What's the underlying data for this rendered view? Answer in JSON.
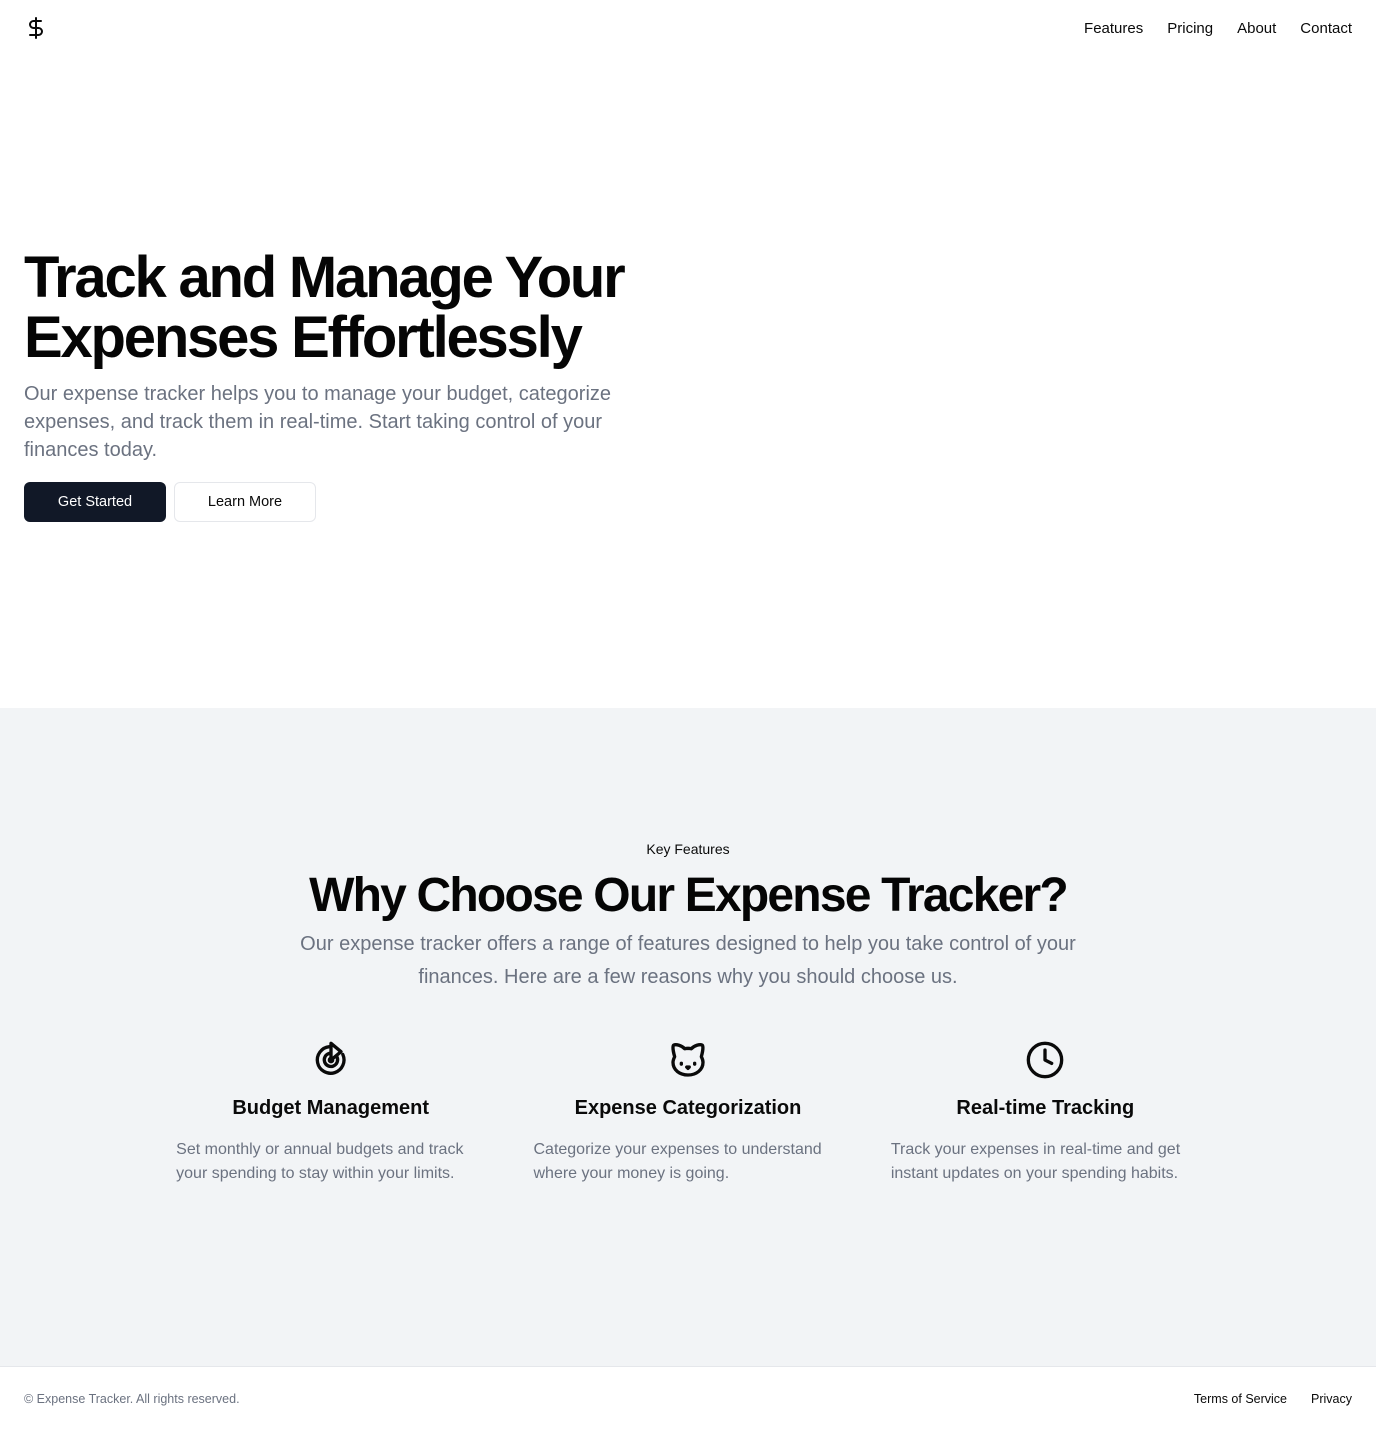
{
  "header": {
    "logo_icon": "dollar-sign-icon",
    "nav": [
      "Features",
      "Pricing",
      "About",
      "Contact"
    ]
  },
  "hero": {
    "title_line1": "Track and Manage Your",
    "title_line2": "Expenses Effortlessly",
    "description": "Our expense tracker helps you to manage your budget, categorize expenses, and track them in real-time. Start taking control of your finances today.",
    "primary_button": "Get Started",
    "secondary_button": "Learn More"
  },
  "features": {
    "eyebrow": "Key Features",
    "title": "Why Choose Our Expense Tracker?",
    "description": "Our expense tracker offers a range of features designed to help you take control of your finances. Here are a few reasons why you should choose us.",
    "items": [
      {
        "icon": "target-icon",
        "title": "Budget Management",
        "description": "Set monthly or annual budgets and track your spending to stay within your limits."
      },
      {
        "icon": "cat-icon",
        "title": "Expense Categorization",
        "description": "Categorize your expenses to understand where your money is going."
      },
      {
        "icon": "clock-icon",
        "title": "Real-time Tracking",
        "description": "Track your expenses in real-time and get instant updates on your spending habits."
      }
    ]
  },
  "footer": {
    "copyright": "© Expense Tracker. All rights reserved.",
    "links": [
      "Terms of Service",
      "Privacy"
    ]
  },
  "colors": {
    "primary": "#111827",
    "muted_text": "#6b7280",
    "section_bg": "#f2f4f6",
    "border": "#e5e7eb"
  }
}
